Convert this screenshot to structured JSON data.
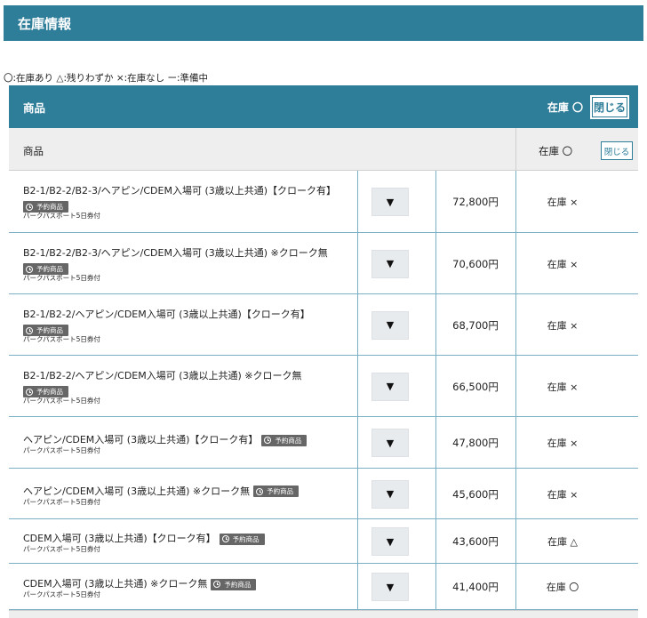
{
  "page": {
    "title": "在庫情報"
  },
  "legend": "〇:在庫あり △:残りわずか ×:在庫なし ー:準備中",
  "panel": {
    "title": "商品",
    "stock_label": "在庫 〇",
    "close_label": "閉じる"
  },
  "table_header": {
    "name": "商品",
    "stock": "在庫 〇",
    "close_label": "閉じる"
  },
  "badge_label": "予約商品",
  "products": [
    {
      "name": "B2-1/B2-2/B2-3/ヘアピン/CDEM入場可 (3歳以上共通)【クローク有】",
      "sub": "パークパスポート5日券付",
      "price": "72,800円",
      "stock": "在庫 ×"
    },
    {
      "name": "B2-1/B2-2/B2-3/ヘアピン/CDEM入場可 (3歳以上共通) ※クローク無",
      "sub": "パークパスポート5日券付",
      "price": "70,600円",
      "stock": "在庫 ×"
    },
    {
      "name": "B2-1/B2-2/ヘアピン/CDEM入場可 (3歳以上共通)【クローク有】",
      "sub": "パークパスポート5日券付",
      "price": "68,700円",
      "stock": "在庫 ×"
    },
    {
      "name": "B2-1/B2-2/ヘアピン/CDEM入場可 (3歳以上共通) ※クローク無",
      "sub": "パークパスポート5日券付",
      "price": "66,500円",
      "stock": "在庫 ×"
    },
    {
      "name": "ヘアピン/CDEM入場可 (3歳以上共通)【クローク有】",
      "sub": "パークパスポート5日券付",
      "price": "47,800円",
      "stock": "在庫 ×"
    },
    {
      "name": "ヘアピン/CDEM入場可 (3歳以上共通) ※クローク無",
      "sub": "パークパスポート5日券付",
      "price": "45,600円",
      "stock": "在庫 ×"
    },
    {
      "name": "CDEM入場可 (3歳以上共通)【クローク有】",
      "sub": "パークパスポート5日券付",
      "price": "43,600円",
      "stock": "在庫 △"
    },
    {
      "name": "CDEM入場可 (3歳以上共通) ※クローク無",
      "sub": "パークパスポート5日券付",
      "price": "41,400円",
      "stock": "在庫 〇"
    }
  ],
  "select_arrow": "▼"
}
